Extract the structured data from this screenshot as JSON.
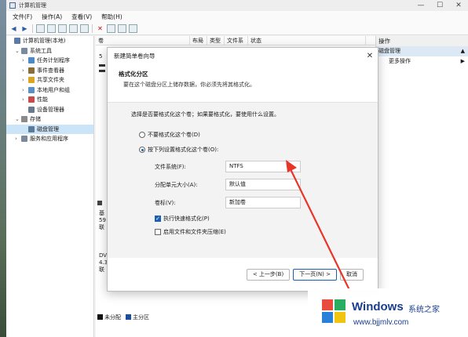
{
  "window": {
    "title": "计算机管理",
    "controls": [
      "—",
      "☐",
      "✕"
    ]
  },
  "menu": [
    "文件(F)",
    "操作(A)",
    "查看(V)",
    "帮助(H)"
  ],
  "tree": [
    {
      "indent": 0,
      "exp": "",
      "label": "计算机管理(本地)",
      "color": "#5b7aa6"
    },
    {
      "indent": 1,
      "exp": "⌄",
      "label": "系统工具",
      "color": "#7a8aa0"
    },
    {
      "indent": 2,
      "exp": "›",
      "label": "任务计划程序",
      "color": "#4b89c8"
    },
    {
      "indent": 2,
      "exp": "›",
      "label": "事件查看器",
      "color": "#8a6d3b"
    },
    {
      "indent": 2,
      "exp": "›",
      "label": "共享文件夹",
      "color": "#d8a623"
    },
    {
      "indent": 2,
      "exp": "›",
      "label": "本地用户和组",
      "color": "#5a8fc8"
    },
    {
      "indent": 2,
      "exp": "›",
      "label": "性能",
      "color": "#c84a4a"
    },
    {
      "indent": 2,
      "exp": "",
      "label": "设备管理器",
      "color": "#6a7a8a"
    },
    {
      "indent": 1,
      "exp": "⌄",
      "label": "存储",
      "color": "#8a8a8a"
    },
    {
      "indent": 2,
      "exp": "",
      "label": "磁盘管理",
      "color": "#5a7a9a",
      "selected": true
    },
    {
      "indent": 1,
      "exp": "›",
      "label": "服务和应用程序",
      "color": "#7a8a9a"
    }
  ],
  "columns": [
    "卷",
    "布局",
    "类型",
    "文件系统",
    "状态"
  ],
  "center_fragments": [
    "5"
  ],
  "disk_rows": [
    {
      "l1": "基",
      "l2": "59",
      "l3": "联"
    },
    {
      "l1": "DV",
      "l2": "4.3",
      "l3": "联"
    }
  ],
  "actions": {
    "heading": "操作",
    "selected": "磁盘管理",
    "items": [
      "更多操作"
    ]
  },
  "legend": [
    {
      "label": "未分配",
      "color": "#111111"
    },
    {
      "label": "主分区",
      "color": "#1a4fa0"
    }
  ],
  "dialog": {
    "title": "新建简单卷向导",
    "heading": "格式化分区",
    "subtitle": "要在这个磁盘分区上储存数据，你必须先将其格式化。",
    "instruction": "选择是否要格式化这个卷；如果要格式化，要使用什么设置。",
    "radio_no_format": "不要格式化这个卷(D)",
    "radio_format": "按下列设置格式化这个卷(O):",
    "filesystem_label": "文件系统(F):",
    "filesystem_value": "NTFS",
    "alloc_label": "分配单元大小(A):",
    "alloc_value": "默认值",
    "volume_label": "卷标(V):",
    "volume_value": "新加卷",
    "quick_format": "执行快速格式化(P)",
    "compression": "启用文件和文件夹压缩(E)",
    "btn_back": "< 上一步(B)",
    "btn_next": "下一页(N) >",
    "btn_cancel": "取消"
  },
  "watermark": {
    "brand": "Windows",
    "suffix": "系统之家",
    "url": "www.bjjmlv.com",
    "logo_colors": [
      "#e74c3c",
      "#27ae60",
      "#2980d9",
      "#f1c40f"
    ]
  }
}
